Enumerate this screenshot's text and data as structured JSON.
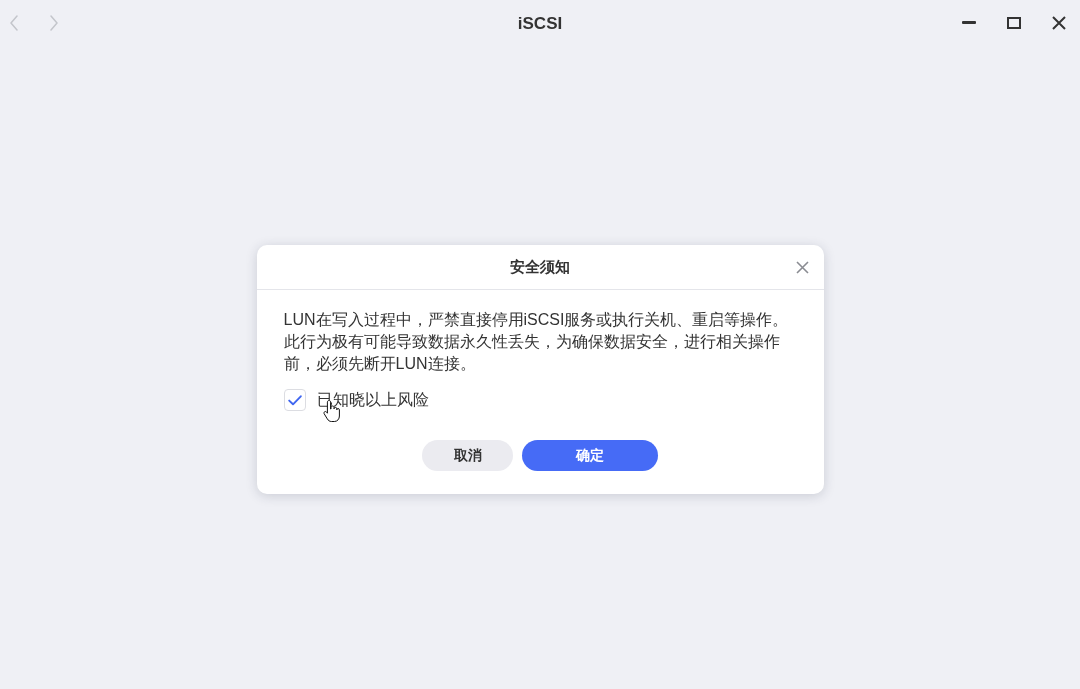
{
  "window": {
    "title": "iSCSI",
    "back_button": {
      "disabled": true
    },
    "forward_button": {
      "disabled": true
    }
  },
  "dialog": {
    "title": "安全须知",
    "message": "LUN在写入过程中，严禁直接停用iSCSI服务或执行关机、重启等操作。此行为极有可能导致数据永久性丢失，为确保数据安全，进行相关操作前，必须先断开LUN连接。",
    "checkbox": {
      "label": "已知晓以上风险",
      "checked": true
    },
    "buttons": [
      {
        "label": "取消",
        "kind": "secondary"
      },
      {
        "label": "确定",
        "kind": "primary"
      }
    ]
  }
}
